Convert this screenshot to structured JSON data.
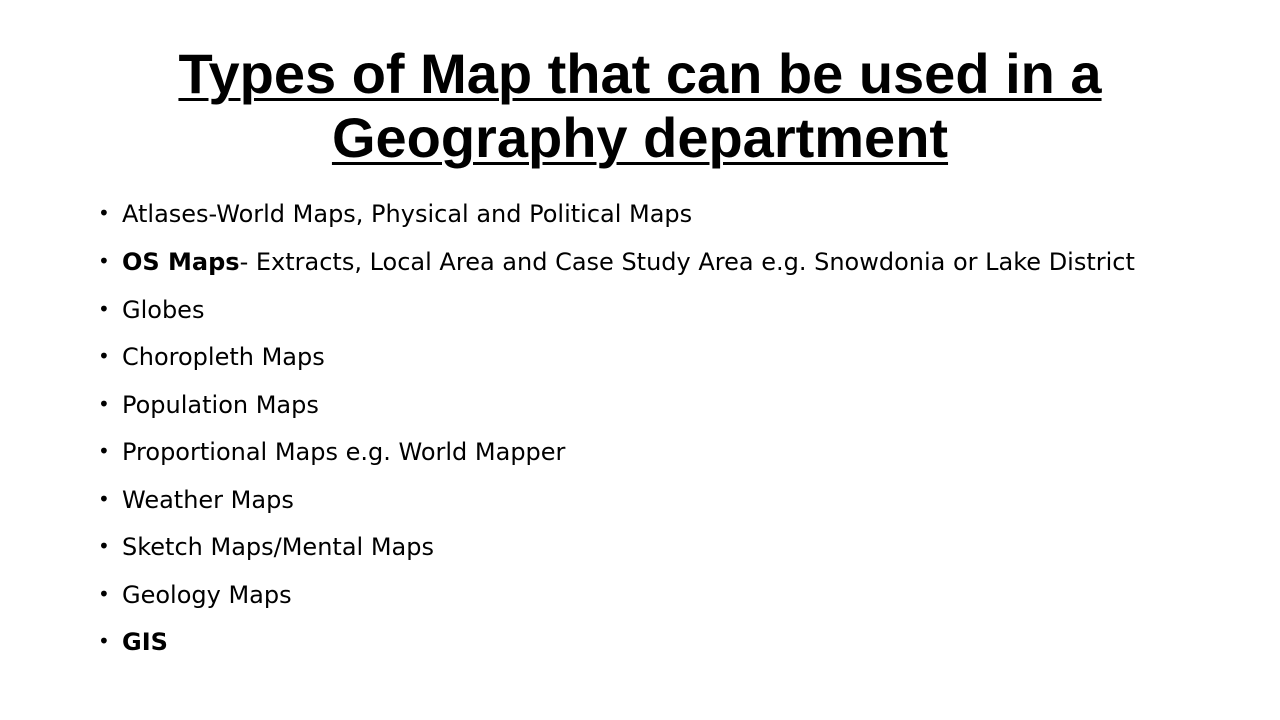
{
  "slide": {
    "title_line1": "Types of Map that can be used in a",
    "title_line2": "Geography  department",
    "bullet_symbol": "•",
    "bullets": [
      {
        "text": "Atlases-World Maps, Physical and Political Maps"
      },
      {
        "bold": "OS Maps",
        "text": "- Extracts, Local Area and Case Study Area e.g. Snowdonia or Lake District"
      },
      {
        "text": "Globes"
      },
      {
        "text": "Choropleth Maps"
      },
      {
        "text": "Population Maps"
      },
      {
        "text": "Proportional Maps e.g. World Mapper"
      },
      {
        "text": "Weather Maps"
      },
      {
        "text": "Sketch Maps/Mental Maps"
      },
      {
        "text": "Geology Maps"
      },
      {
        "bold": "GIS"
      }
    ]
  }
}
